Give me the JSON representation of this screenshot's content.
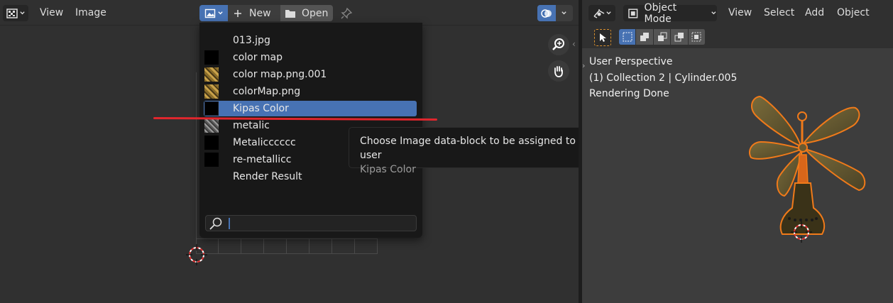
{
  "image_editor": {
    "menu": {
      "view": "View",
      "image": "Image"
    },
    "new_label": "New",
    "open_label": "Open",
    "dropdown": {
      "items": [
        {
          "label": "013.jpg",
          "thumb": "none"
        },
        {
          "label": "color map",
          "thumb": "black"
        },
        {
          "label": "color map.png.001",
          "thumb": "gold"
        },
        {
          "label": "colorMap.png",
          "thumb": "gold"
        },
        {
          "label": "Kipas Color",
          "thumb": "black",
          "selected": true
        },
        {
          "label": "metalic",
          "thumb": "gray"
        },
        {
          "label": "Metalicccccc",
          "thumb": "black"
        },
        {
          "label": "re-metallicc",
          "thumb": "black"
        },
        {
          "label": "Render Result",
          "thumb": "none"
        }
      ],
      "search_value": ""
    },
    "tooltip": {
      "title": "Choose Image data-block to be assigned to this user",
      "value": "Kipas Color"
    }
  },
  "viewport": {
    "mode": "Object Mode",
    "menu": {
      "view": "View",
      "select": "Select",
      "add": "Add",
      "object": "Object"
    },
    "overlay": {
      "line1": "User Perspective",
      "line2": "(1) Collection 2 | Cylinder.005",
      "line3": "Rendering Done"
    }
  },
  "colors": {
    "accent": "#4772b3",
    "selection_outline": "#f07a1a",
    "annotation_red": "#e0262d"
  }
}
